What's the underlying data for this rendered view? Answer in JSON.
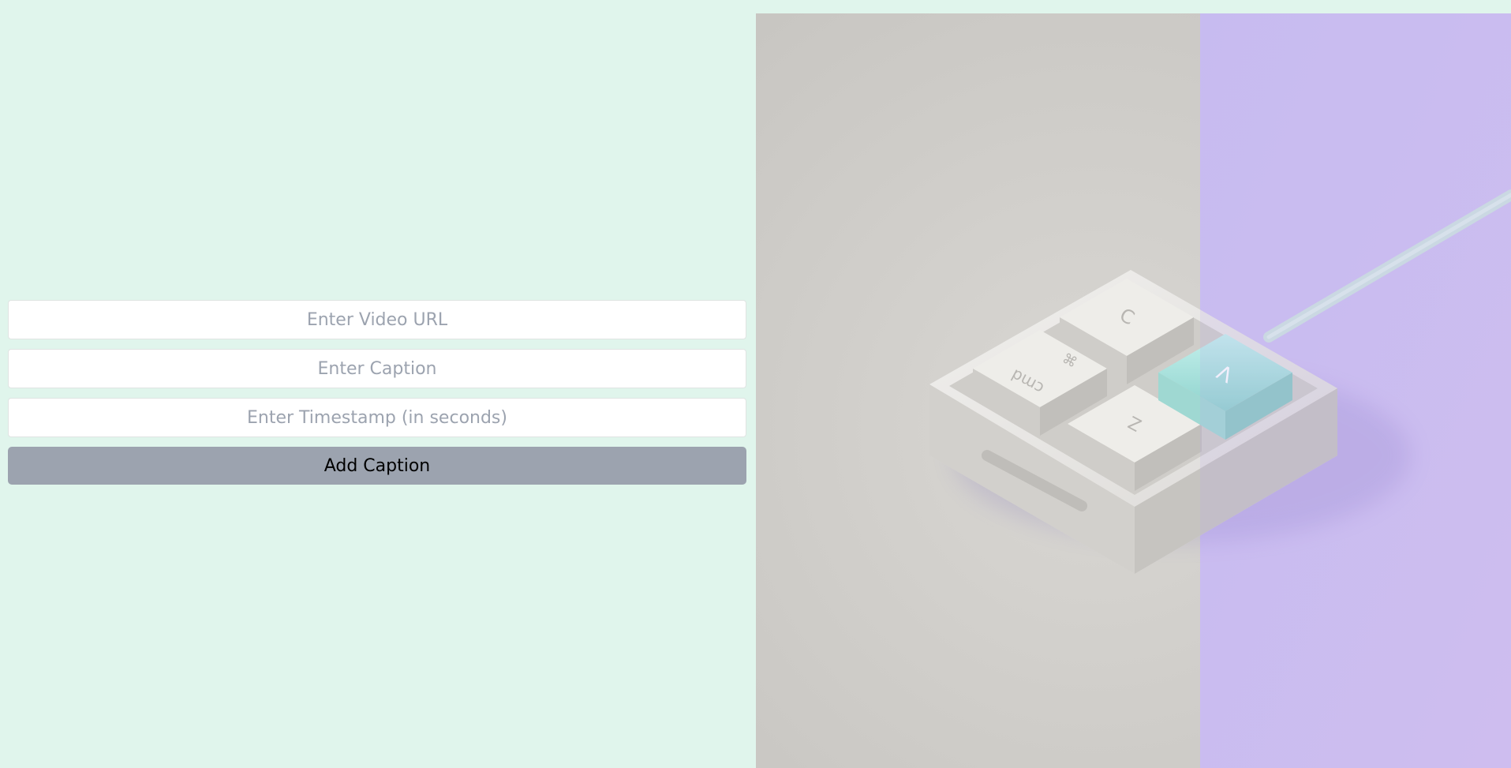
{
  "form": {
    "video_url_placeholder": "Enter Video URL",
    "caption_placeholder": "Enter Caption",
    "timestamp_placeholder": "Enter Timestamp (in seconds)",
    "add_button_label": "Add Caption"
  },
  "video": {
    "keycaps": {
      "top": "C",
      "cmd_symbol": "⌘",
      "cmd_label": "cmd",
      "bottom": "Z",
      "accent": "V"
    }
  },
  "colors": {
    "page_background": "#e0f5ec",
    "button_background": "#9ca3af",
    "video_neutral": "#cfcdca",
    "video_purple": "#cdbff2",
    "accent_key": "#a8e3df"
  }
}
